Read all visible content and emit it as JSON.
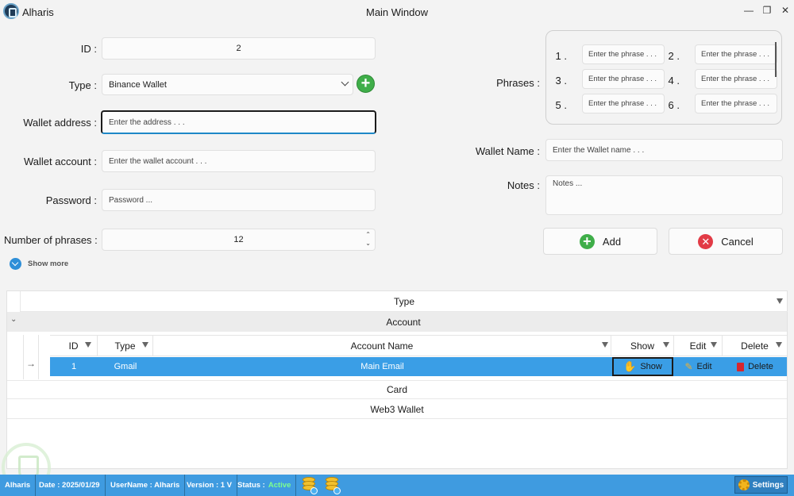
{
  "window": {
    "app_name": "Alharis",
    "title": "Main Window"
  },
  "form": {
    "id_label": "ID :",
    "id_value": "2",
    "type_label": "Type :",
    "type_value": "Binance Wallet",
    "address_label": "Wallet address :",
    "address_placeholder": "Enter the address . . .",
    "account_label": "Wallet account :",
    "account_placeholder": "Enter the wallet account . . .",
    "password_label": "Password :",
    "password_placeholder": "Password ...",
    "phrases_count_label": "Number of phrases :",
    "phrases_count_value": "12",
    "show_more": "Show more"
  },
  "phrases": {
    "label": "Phrases :",
    "items": [
      {
        "num": "1 .",
        "placeholder": "Enter the phrase . . ."
      },
      {
        "num": "2 .",
        "placeholder": "Enter the phrase . . ."
      },
      {
        "num": "3 .",
        "placeholder": "Enter the phrase . . ."
      },
      {
        "num": "4 .",
        "placeholder": "Enter the phrase . . ."
      },
      {
        "num": "5 .",
        "placeholder": "Enter the phrase . . ."
      },
      {
        "num": "6 .",
        "placeholder": "Enter the phrase . . ."
      }
    ]
  },
  "wallet_name": {
    "label": "Wallet Name :",
    "placeholder": "Enter the Wallet name . . ."
  },
  "notes": {
    "label": "Notes :",
    "placeholder": "Notes ..."
  },
  "actions": {
    "add": "Add",
    "cancel": "Cancel"
  },
  "grid": {
    "group_header": "Type",
    "groups": [
      "Account",
      "Card",
      "Web3 Wallet"
    ],
    "columns": [
      "ID",
      "Type",
      "Account Name",
      "Show",
      "Edit",
      "Delete"
    ],
    "rows": [
      {
        "id": "1",
        "type": "Gmail",
        "name": "Main Email",
        "show": "Show",
        "edit": "Edit",
        "delete": "Delete"
      }
    ]
  },
  "status": {
    "app": "Alharis",
    "date": "Date : 2025/01/29",
    "username": "UserName : Alharis",
    "version": "Version : 1 V",
    "status_label": "Status :",
    "status_value": "Active",
    "settings": "Settings"
  },
  "colors": {
    "accent": "#3f9be0",
    "selected_row": "#3a9ee6",
    "add_green": "#3fae49",
    "cancel_red": "#e23b46",
    "status_active": "#7dff8f"
  }
}
